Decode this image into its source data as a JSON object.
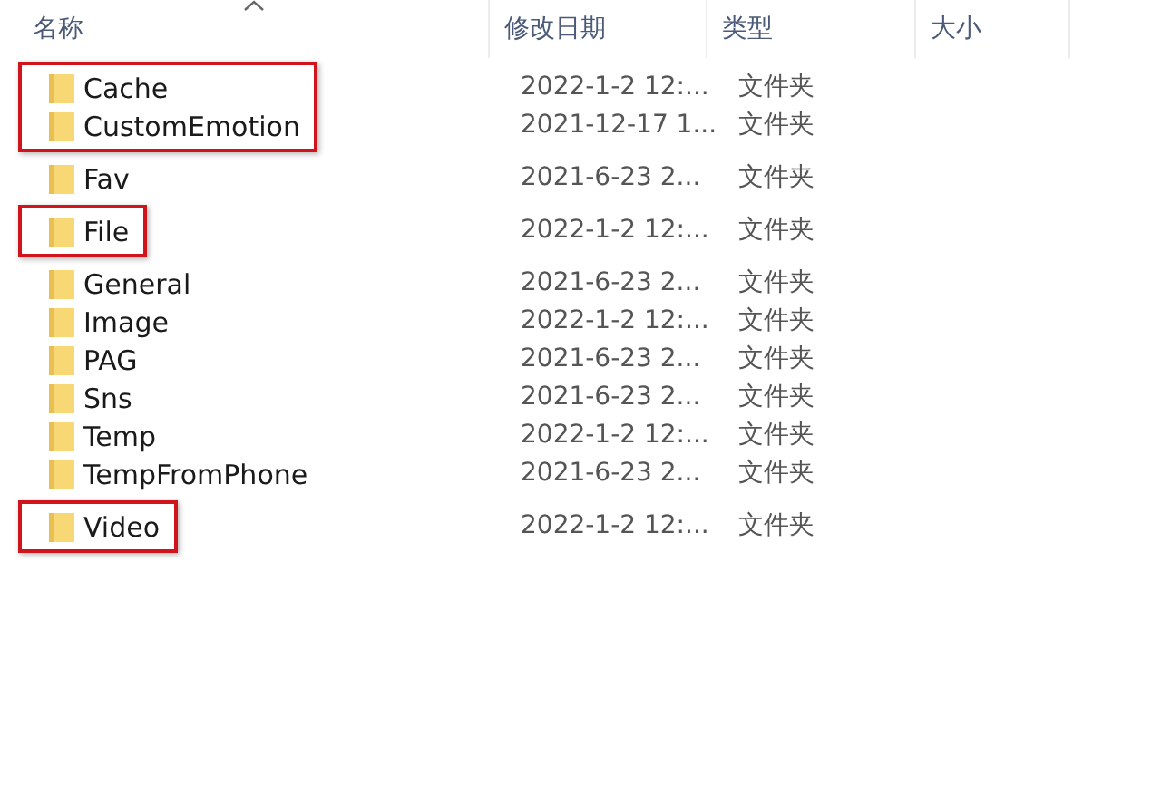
{
  "columns": [
    {
      "label": "名称",
      "sorted": true
    },
    {
      "label": "修改日期",
      "sorted": false
    },
    {
      "label": "类型",
      "sorted": false
    },
    {
      "label": "大小",
      "sorted": false
    }
  ],
  "groups": [
    {
      "highlighted": true,
      "rows": [
        {
          "name": "Cache",
          "date": "2022-1-2 12:...",
          "type": "文件夹"
        },
        {
          "name": "CustomEmotion",
          "date": "2021-12-17 1...",
          "type": "文件夹"
        }
      ]
    },
    {
      "highlighted": false,
      "rows": [
        {
          "name": "Fav",
          "date": "2021-6-23 2...",
          "type": "文件夹"
        }
      ]
    },
    {
      "highlighted": true,
      "rows": [
        {
          "name": "File",
          "date": "2022-1-2 12:...",
          "type": "文件夹"
        }
      ]
    },
    {
      "highlighted": false,
      "rows": [
        {
          "name": "General",
          "date": "2021-6-23 2...",
          "type": "文件夹"
        },
        {
          "name": "Image",
          "date": "2022-1-2 12:...",
          "type": "文件夹"
        },
        {
          "name": "PAG",
          "date": "2021-6-23 2...",
          "type": "文件夹"
        },
        {
          "name": "Sns",
          "date": "2021-6-23 2...",
          "type": "文件夹"
        },
        {
          "name": "Temp",
          "date": "2022-1-2 12:...",
          "type": "文件夹"
        },
        {
          "name": "TempFromPhone",
          "date": "2021-6-23 2...",
          "type": "文件夹"
        }
      ]
    },
    {
      "highlighted": true,
      "rows": [
        {
          "name": "Video",
          "date": "2022-1-2 12:...",
          "type": "文件夹"
        }
      ]
    }
  ]
}
